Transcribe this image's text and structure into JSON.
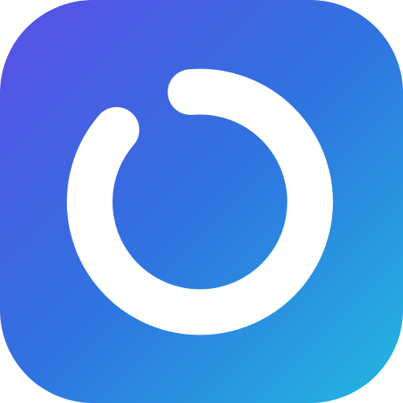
{
  "icon": {
    "name": "circular-ring-logo",
    "colors": {
      "gradient_top_left": "#5a4fe6",
      "gradient_middle": "#2f73e0",
      "gradient_bottom_right": "#22b8e0",
      "ring": "#ffffff"
    }
  }
}
